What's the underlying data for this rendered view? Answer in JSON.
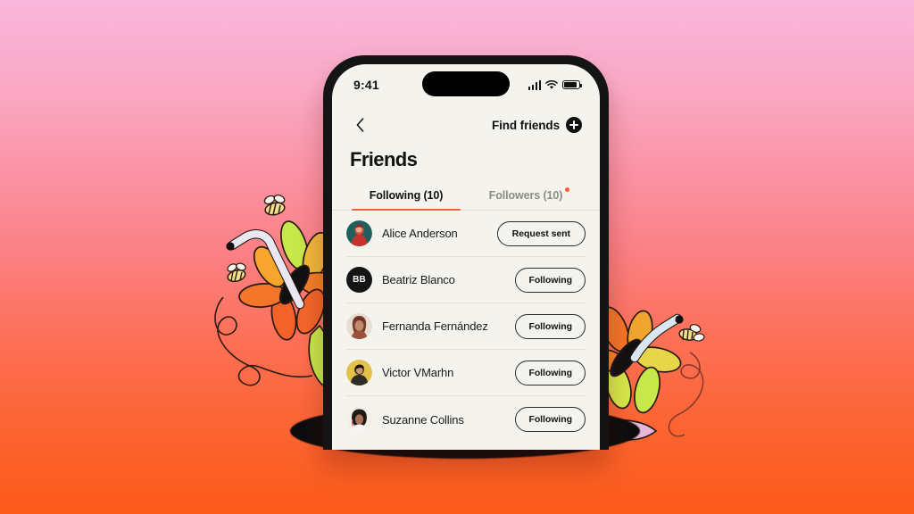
{
  "background": {
    "gradient_top": "#f9b6dc",
    "gradient_bottom": "#fb5a18",
    "decorations": [
      "flower-straw-bees-left",
      "flower-straw-bee-right"
    ]
  },
  "phone": {
    "frame_color": "#141414",
    "screen_bg": "#f4f3ee",
    "status_bar": {
      "time": "9:41",
      "icons": [
        "cellular-signal-icon",
        "wifi-icon",
        "battery-icon"
      ],
      "dynamic_island": "dynamic-island"
    },
    "nav": {
      "back_icon": "chevron-left-icon",
      "find_friends_label": "Find friends",
      "plus_icon": "plus-circle-icon"
    },
    "title": "Friends",
    "tabs": [
      {
        "label": "Following (10)",
        "active": true,
        "badge": false
      },
      {
        "label": "Followers (10)",
        "active": false,
        "badge": true
      }
    ],
    "accent_color": "#e8653a",
    "badge_color": "#f0603a",
    "friends": [
      {
        "name": "Alice Anderson",
        "avatar_type": "photo",
        "avatar_bg": "#1f5f5c",
        "action": "Request sent",
        "initials": ""
      },
      {
        "name": "Beatriz Blanco",
        "avatar_type": "initials",
        "avatar_bg": "#151515",
        "action": "Following",
        "initials": "BB"
      },
      {
        "name": "Fernanda Fernández",
        "avatar_type": "photo",
        "avatar_bg": "#e8ddd2",
        "action": "Following",
        "initials": ""
      },
      {
        "name": "Victor VMarhn",
        "avatar_type": "photo",
        "avatar_bg": "#e3c14a",
        "action": "Following",
        "initials": ""
      },
      {
        "name": "Suzanne Collins",
        "avatar_type": "photo",
        "avatar_bg": "#f2efe9",
        "action": "Following",
        "initials": ""
      }
    ]
  }
}
